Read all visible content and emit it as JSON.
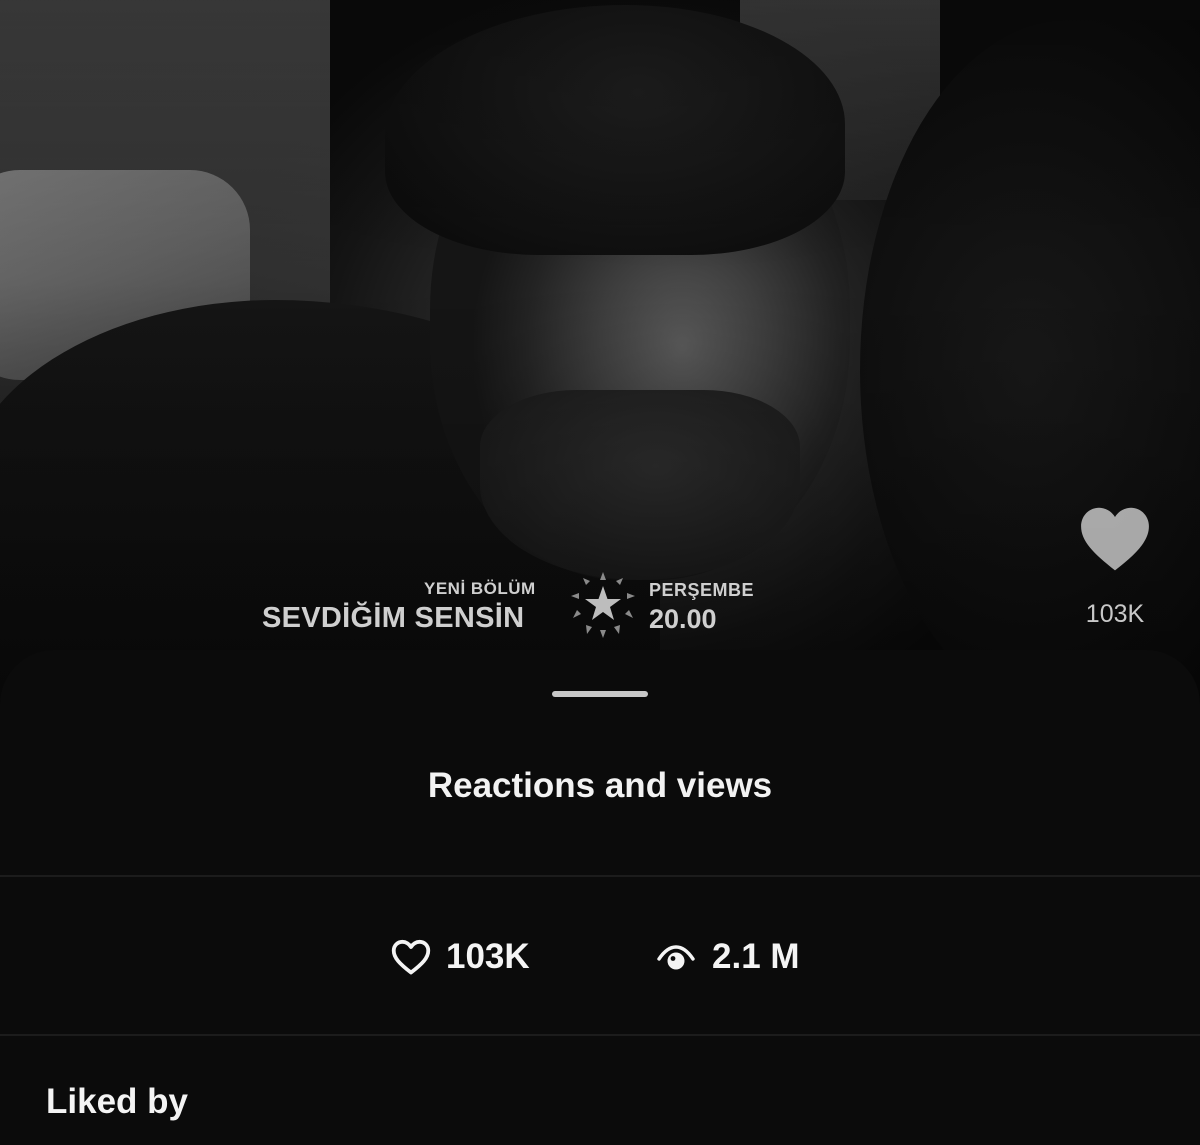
{
  "media": {
    "broadcast": {
      "subtitle": "YENİ BÖLÜM",
      "title": "SEVDİĞİM SENSİN",
      "day": "PERŞEMBE",
      "time": "20.00"
    },
    "like_icon": "heart-icon",
    "like_count": "103K"
  },
  "sheet": {
    "title": "Reactions and views",
    "stats": {
      "likes_icon": "heart-outline-icon",
      "likes": "103K",
      "views_icon": "eye-icon",
      "views": "2.1 M"
    },
    "liked_by_heading": "Liked by"
  },
  "colors": {
    "background": "#000000",
    "sheet": "#0b0b0b",
    "text": "#f4f4f4",
    "muted": "#c8c8c8"
  }
}
